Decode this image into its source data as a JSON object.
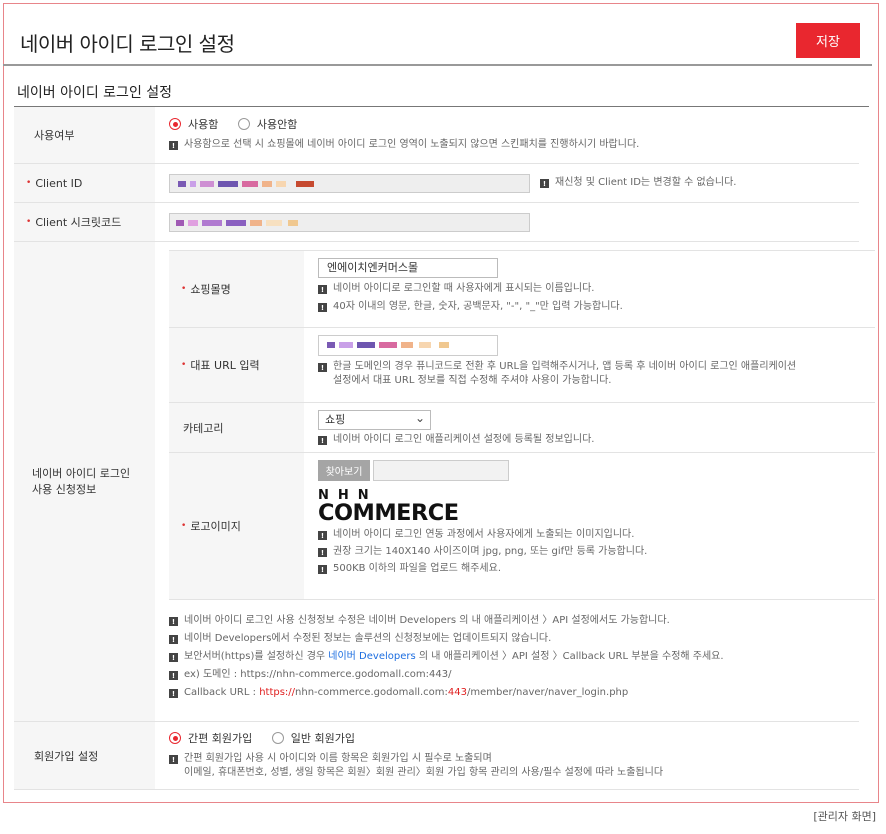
{
  "header": {
    "title": "네이버 아이디 로그인 설정",
    "save_label": "저장"
  },
  "section": {
    "title": "네이버 아이디 로그인 설정"
  },
  "usage": {
    "label": "사용여부",
    "options": [
      "사용함",
      "사용안함"
    ],
    "selected": "사용함",
    "note": "사용함으로 선택 시 쇼핑몰에 네이버 아이디 로그인 영역이 노출되지 않으면 스킨패치를 진행하시기 바랍니다."
  },
  "client_id": {
    "label": "Client ID",
    "note": "재신청 및 Client ID는 변경할 수 없습니다."
  },
  "client_secret": {
    "label": "Client 시크릿코드"
  },
  "apply": {
    "label_line1": "네이버 아이디 로그인",
    "label_line2": "사용 신청정보",
    "shop_name": {
      "label": "쇼핑몰명",
      "value": "엔에이치엔커머스몰",
      "notes": [
        "네이버 아이디로 로그인할 때 사용자에게 표시되는 이름입니다.",
        "40자 이내의 영문, 한글, 숫자, 공백문자, \"-\", \"_\"만 입력 가능합니다."
      ]
    },
    "url": {
      "label": "대표 URL 입력",
      "note_line1": "한글 도메인의 경우 퓨니코드로 전환 후 URL을 입력해주시거나, 앱 등록 후 네이버 아이디 로그인 애플리케이션",
      "note_line2": "설정에서 대표 URL 정보를 직접 수정해 주셔야 사용이 가능합니다."
    },
    "category": {
      "label": "카테고리",
      "value": "쇼핑",
      "note": "네이버 아이디 로그인 애플리케이션 설정에 등록될 정보입니다."
    },
    "logo": {
      "label": "로고이미지",
      "find_label": "찾아보기",
      "logo_top": "NHN",
      "logo_bottom": "COMMERCE",
      "notes": [
        "네이버 아이디 로그인 연동 과정에서 사용자에게 노출되는 이미지입니다.",
        "권장 크기는 140X140 사이즈이며 jpg, png, 또는 gif만 등록 가능합니다.",
        "500KB 이하의 파일을 업로드 해주세요."
      ]
    },
    "bottom_notes": {
      "n1": "네이버 아이디 로그인 사용 신청정보 수정은 네이버 Developers 의 내 애플리케이션 〉API 설정에서도 가능합니다.",
      "n2": "네이버 Developers에서 수정된 정보는 솔루션의 신청정보에는 업데이트되지 않습니다.",
      "n3_pre": "보안서버(https)를 설정하신 경우 ",
      "n3_link": "네이버 Developers",
      "n3_post": " 의 내 애플리케이션 〉API 설정 〉Callback URL 부분을 수정해 주세요.",
      "n4": "ex) 도메인 : https://nhn-commerce.godomall.com:443/",
      "n5_pre": "Callback URL : ",
      "n5_red": "https://",
      "n5_mid": "nhn-commerce.godomall.com:",
      "n5_red2": "443",
      "n5_post": "/member/naver/naver_login.php"
    }
  },
  "signup": {
    "label": "회원가입 설정",
    "options": [
      "간편 회원가입",
      "일반 회원가입"
    ],
    "selected": "간편 회원가입",
    "note_line1": "간편 회원가입 사용 시 아이디와 이름 항목은 회원가입 시 필수로 노출되며",
    "note_line2": "이메일, 휴대폰번호, 성별, 생일 항목은 회원〉회원 관리〉회원 가입 항목 관리의 사용/필수 설정에 따라 노출됩니다"
  },
  "footer": {
    "caption": "[관리자 화면]"
  },
  "colors": {
    "accent": "#e9272f",
    "link": "#1d6ee0",
    "border": "#e8858a"
  }
}
